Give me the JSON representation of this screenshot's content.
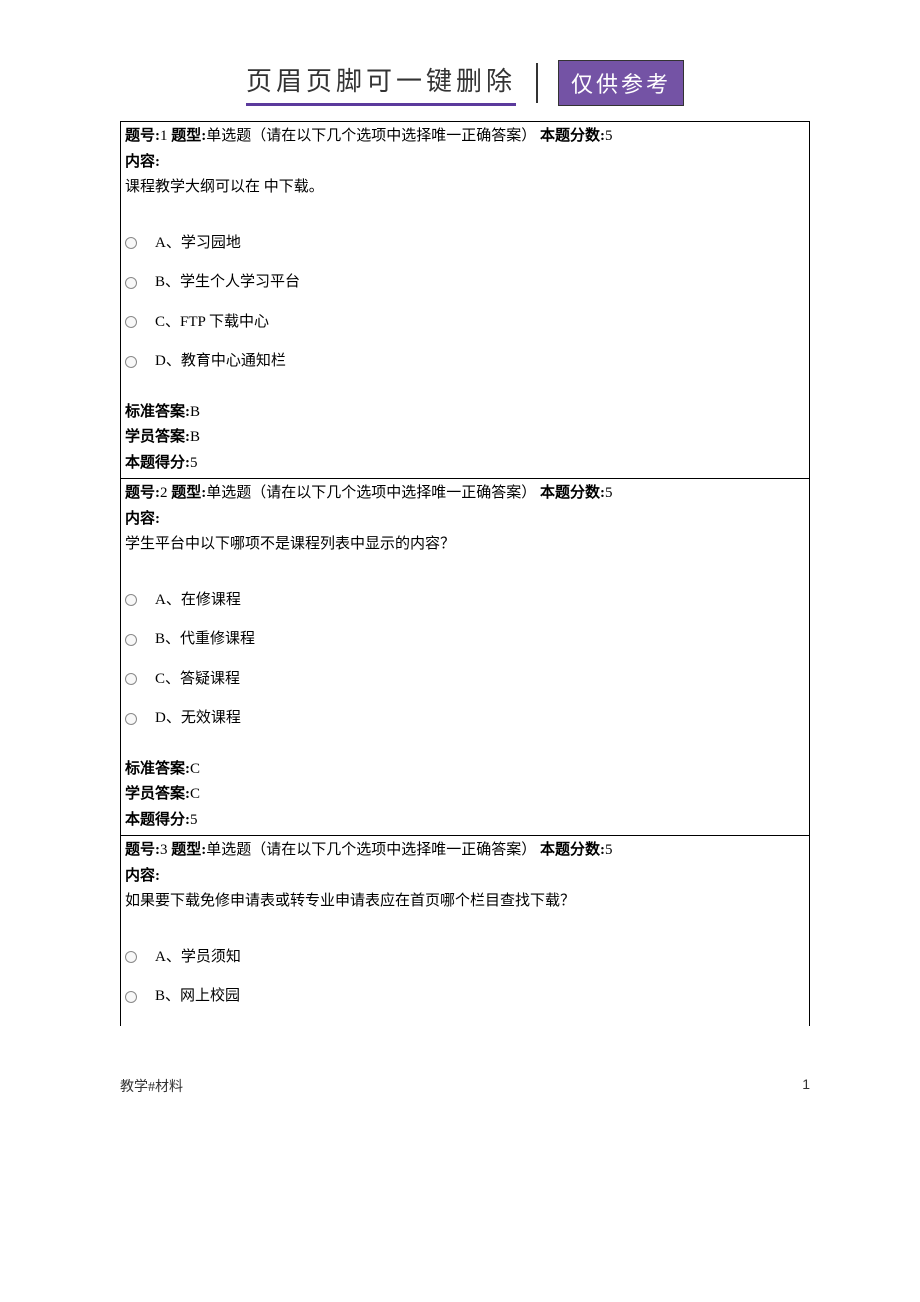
{
  "header": {
    "title": "页眉页脚可一键删除",
    "badge": "仅供参考"
  },
  "labels": {
    "question_num_label": "题号:",
    "question_type_label": "题型:",
    "question_type_value": "单选题（请在以下几个选项中选择唯一正确答案）",
    "score_label": "本题分数:",
    "content_label": "内容:",
    "standard_answer_label": "标准答案:",
    "student_answer_label": "学员答案:",
    "earned_score_label": "本题得分:"
  },
  "questions": [
    {
      "num": "1",
      "score": "5",
      "content": "课程教学大纲可以在 中下载。",
      "options": [
        {
          "label": "A、学习园地"
        },
        {
          "label": "B、学生个人学习平台"
        },
        {
          "label": "C、FTP 下载中心"
        },
        {
          "label": "D、教育中心通知栏"
        }
      ],
      "standard_answer": "B",
      "student_answer": "B",
      "earned_score": "5"
    },
    {
      "num": "2",
      "score": "5",
      "content": "学生平台中以下哪项不是课程列表中显示的内容？",
      "options": [
        {
          "label": "A、在修课程"
        },
        {
          "label": "B、代重修课程"
        },
        {
          "label": "C、答疑课程"
        },
        {
          "label": "D、无效课程"
        }
      ],
      "standard_answer": "C",
      "student_answer": "C",
      "earned_score": "5"
    },
    {
      "num": "3",
      "score": "5",
      "content": "如果要下载免修申请表或转专业申请表应在首页哪个栏目查找下载？",
      "options": [
        {
          "label": "A、学员须知"
        },
        {
          "label": "B、网上校园"
        }
      ],
      "standard_answer": null,
      "student_answer": null,
      "earned_score": null
    }
  ],
  "footer": {
    "left": "教学#材料",
    "page": "1"
  }
}
